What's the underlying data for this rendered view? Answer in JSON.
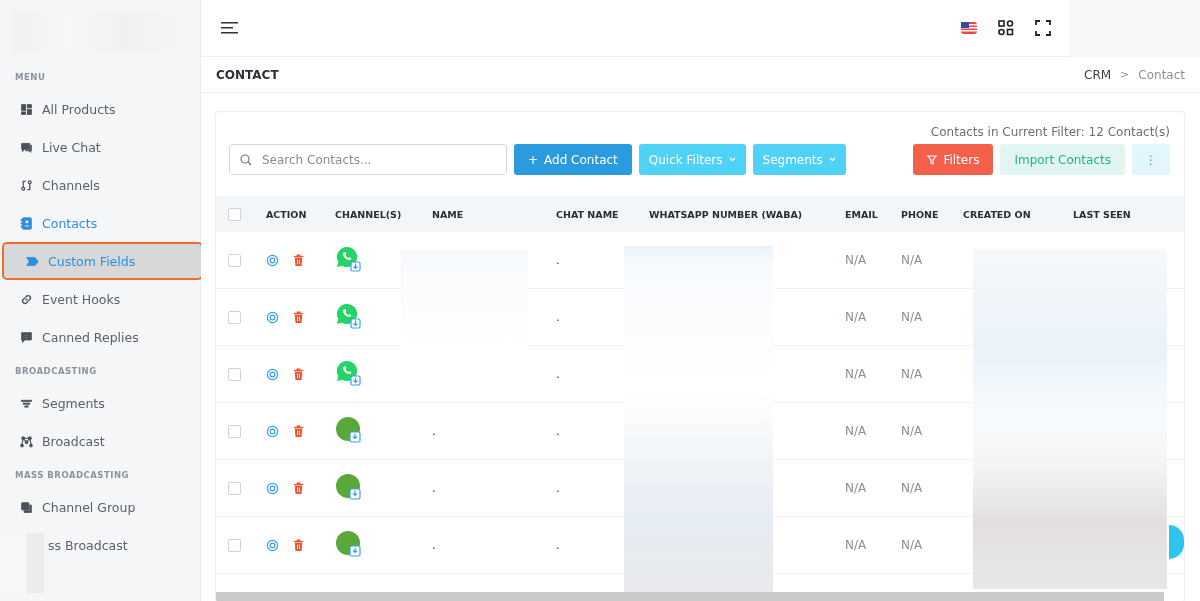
{
  "sidebar": {
    "sections": [
      {
        "heading": "MENU",
        "items": [
          {
            "label": "All Products",
            "selected": false,
            "sub": false
          },
          {
            "label": "Live Chat",
            "selected": false,
            "sub": false
          },
          {
            "label": "Channels",
            "selected": false,
            "sub": false
          },
          {
            "label": "Contacts",
            "selected": true,
            "sub": false
          },
          {
            "label": "Custom Fields",
            "selected": true,
            "sub": true
          },
          {
            "label": "Event Hooks",
            "selected": false,
            "sub": false
          },
          {
            "label": "Canned Replies",
            "selected": false,
            "sub": false
          }
        ]
      },
      {
        "heading": "BROADCASTING",
        "items": [
          {
            "label": "Segments",
            "selected": false,
            "sub": false
          },
          {
            "label": "Broadcast",
            "selected": false,
            "sub": false
          }
        ]
      },
      {
        "heading": "MASS BROADCASTING",
        "items": [
          {
            "label": "Channel Group",
            "selected": false,
            "sub": false
          },
          {
            "label": "ss Broadcast",
            "selected": false,
            "sub": false
          }
        ]
      }
    ]
  },
  "page": {
    "title": "CONTACT",
    "breadcrumb": [
      "CRM",
      "Contact"
    ],
    "breadcrumb_separator": ">"
  },
  "toolbar": {
    "count": "Contacts in Current Filter: 12 Contact(s)",
    "search_placeholder": "Search Contacts...",
    "add_icon": "+",
    "add_label": "Add Contact",
    "quick_filters": "Quick Filters",
    "segments": "Segments",
    "filters": "Filters",
    "import": "Import Contacts",
    "more": "⋮"
  },
  "table": {
    "select_all_checked": false,
    "columns": [
      "ACTION",
      "CHANNEL(S)",
      "NAME",
      "CHAT NAME",
      "WHATSAPP NUMBER (WABA)",
      "EMAIL",
      "PHONE",
      "CREATED ON",
      "LAST SEEN"
    ],
    "rows": [
      {
        "kind": "whatsapp",
        "checked": false,
        "chat_name": ".",
        "email": "N/A",
        "phone": "N/A"
      },
      {
        "kind": "whatsapp",
        "checked": false,
        "chat_name": ".",
        "email": "N/A",
        "phone": "N/A"
      },
      {
        "kind": "whatsapp",
        "checked": false,
        "chat_name": ".",
        "email": "N/A",
        "phone": "N/A"
      },
      {
        "kind": "avatar",
        "checked": false,
        "name": ".",
        "chat_name": ".",
        "email": "N/A",
        "phone": "N/A"
      },
      {
        "kind": "avatar",
        "checked": false,
        "name": ".",
        "chat_name": ".",
        "email": "N/A",
        "phone": "N/A"
      },
      {
        "kind": "avatar",
        "checked": false,
        "name": ".",
        "chat_name": ".",
        "email": "N/A",
        "phone": "N/A"
      }
    ]
  }
}
